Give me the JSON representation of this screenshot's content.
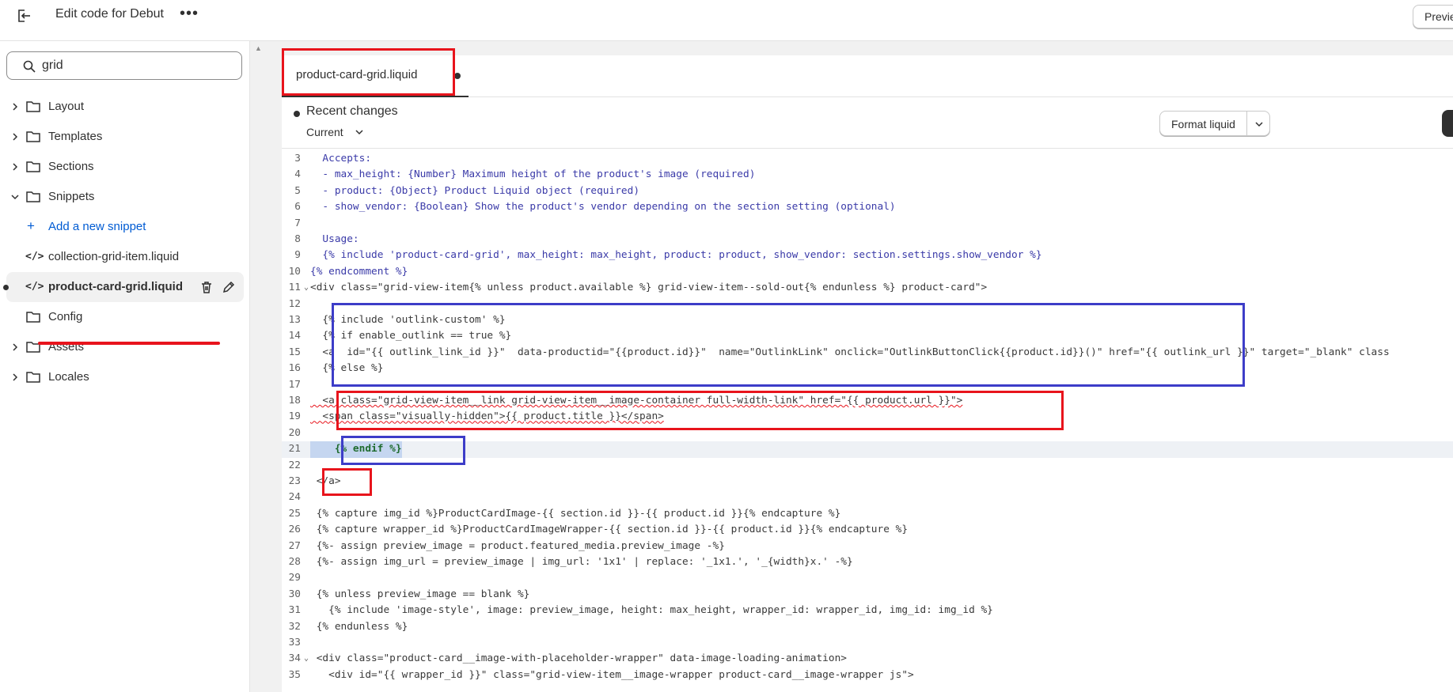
{
  "topbar": {
    "title": "Edit code for Debut",
    "more_label": "•••",
    "preview_label": "Preview"
  },
  "sidebar": {
    "search_value": "grid",
    "folders_top": [
      {
        "label": "Layout"
      },
      {
        "label": "Templates"
      },
      {
        "label": "Sections"
      },
      {
        "label": "Snippets"
      }
    ],
    "add_snippet": "Add a new snippet",
    "files": [
      {
        "label": "collection-grid-item.liquid"
      },
      {
        "label": "product-card-grid.liquid"
      }
    ],
    "folders_bottom": [
      {
        "label": "Config"
      },
      {
        "label": "Assets"
      },
      {
        "label": "Locales"
      }
    ],
    "code_glyph": "</>"
  },
  "editor": {
    "tab_label": "product-card-grid.liquid",
    "changes_title": "Recent changes",
    "current_label": "Current",
    "format_label": "Format liquid"
  },
  "code_lines": [
    {
      "n": "3",
      "text": "  Accepts:"
    },
    {
      "n": "4",
      "text": "  - max_height: {Number} Maximum height of the product's image (required)"
    },
    {
      "n": "5",
      "text": "  - product: {Object} Product Liquid object (required)"
    },
    {
      "n": "6",
      "text": "  - show_vendor: {Boolean} Show the product's vendor depending on the section setting (optional)"
    },
    {
      "n": "7",
      "text": ""
    },
    {
      "n": "8",
      "text": "  Usage:"
    },
    {
      "n": "9",
      "text": "  {% include 'product-card-grid', max_height: max_height, product: product, show_vendor: section.settings.show_vendor %}"
    },
    {
      "n": "10",
      "text": "{% endcomment %}"
    },
    {
      "n": "11",
      "text": "<div class=\"grid-view-item{% unless product.available %} grid-view-item--sold-out{% endunless %} product-card\">"
    },
    {
      "n": "12",
      "text": ""
    },
    {
      "n": "13",
      "text": "  {% include 'outlink-custom' %}"
    },
    {
      "n": "14",
      "text": "  {% if enable_outlink == true %}"
    },
    {
      "n": "15",
      "text": "  <a  id=\"{{ outlink_link_id }}\"  data-productid=\"{{product.id}}\"  name=\"OutlinkLink\" onclick=\"OutlinkButtonClick{{product.id}}()\" href=\"{{ outlink_url }}\" target=\"_blank\" class"
    },
    {
      "n": "16",
      "text": "  {% else %}"
    },
    {
      "n": "17",
      "text": ""
    },
    {
      "n": "18",
      "text": "  <a class=\"grid-view-item__link grid-view-item__image-container full-width-link\" href=\"{{ product.url }}\">"
    },
    {
      "n": "19",
      "text": "  <span class=\"visually-hidden\">{{ product.title }}</span>"
    },
    {
      "n": "20",
      "text": ""
    },
    {
      "n": "21",
      "text": "    {% endif %}"
    },
    {
      "n": "22",
      "text": ""
    },
    {
      "n": "23",
      "text": " </a>"
    },
    {
      "n": "24",
      "text": ""
    },
    {
      "n": "25",
      "text": " {% capture img_id %}ProductCardImage-{{ section.id }}-{{ product.id }}{% endcapture %}"
    },
    {
      "n": "26",
      "text": " {% capture wrapper_id %}ProductCardImageWrapper-{{ section.id }}-{{ product.id }}{% endcapture %}"
    },
    {
      "n": "27",
      "text": " {%- assign preview_image = product.featured_media.preview_image -%}"
    },
    {
      "n": "28",
      "text": " {%- assign img_url = preview_image | img_url: '1x1' | replace: '_1x1.', '_{width}x.' -%}"
    },
    {
      "n": "29",
      "text": ""
    },
    {
      "n": "30",
      "text": " {% unless preview_image == blank %}"
    },
    {
      "n": "31",
      "text": "   {% include 'image-style', image: preview_image, height: max_height, wrapper_id: wrapper_id, img_id: img_id %}"
    },
    {
      "n": "32",
      "text": " {% endunless %}"
    },
    {
      "n": "33",
      "text": ""
    },
    {
      "n": "34",
      "text": " <div class=\"product-card__image-with-placeholder-wrapper\" data-image-loading-animation>"
    },
    {
      "n": "35",
      "text": "   <div id=\"{{ wrapper_id }}\" class=\"grid-view-item__image-wrapper product-card__image-wrapper js\">"
    }
  ],
  "colors": {
    "annotation_red": "#e8141c",
    "annotation_blue": "#3d3dc8",
    "link_blue": "#005bd3"
  }
}
